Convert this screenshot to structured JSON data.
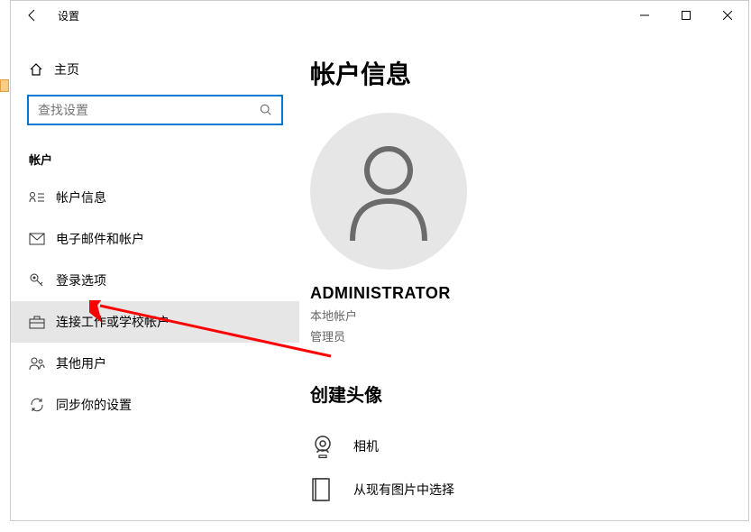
{
  "window": {
    "title": "设置"
  },
  "sidebar": {
    "home_label": "主页",
    "search_placeholder": "查找设置",
    "section_header": "帐户",
    "items": [
      {
        "label": "帐户信息",
        "selected": false
      },
      {
        "label": "电子邮件和帐户",
        "selected": false
      },
      {
        "label": "登录选项",
        "selected": false
      },
      {
        "label": "连接工作或学校帐户",
        "selected": true
      },
      {
        "label": "其他用户",
        "selected": false
      },
      {
        "label": "同步你的设置",
        "selected": false
      }
    ]
  },
  "main": {
    "heading": "帐户信息",
    "username": "ADMINISTRATOR",
    "account_type": "本地帐户",
    "role": "管理员",
    "create_avatar_heading": "创建头像",
    "options": [
      {
        "label": "相机"
      },
      {
        "label": "从现有图片中选择"
      }
    ]
  }
}
